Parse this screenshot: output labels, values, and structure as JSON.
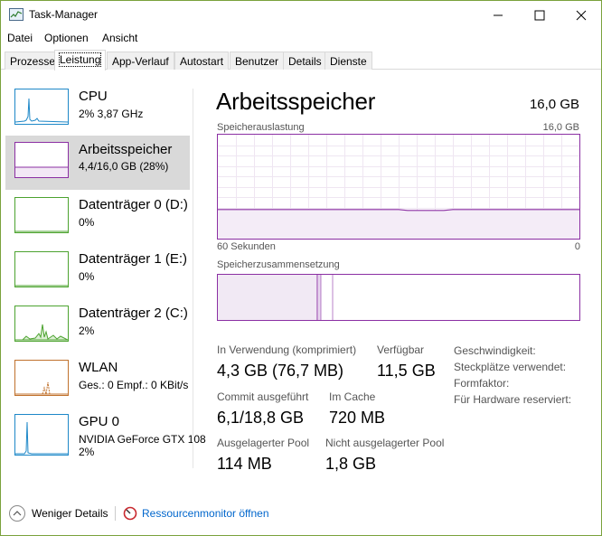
{
  "window": {
    "title": "Task-Manager"
  },
  "menu": {
    "file": "Datei",
    "options": "Optionen",
    "view": "Ansicht"
  },
  "tabs": [
    {
      "label": "Prozesse",
      "active": false
    },
    {
      "label": "Leistung",
      "active": true
    },
    {
      "label": "App-Verlauf",
      "active": false
    },
    {
      "label": "Autostart",
      "active": false
    },
    {
      "label": "Benutzer",
      "active": false
    },
    {
      "label": "Details",
      "active": false
    },
    {
      "label": "Dienste",
      "active": false
    }
  ],
  "sidebar": {
    "items": [
      {
        "title": "CPU",
        "sub": "2%  3,87 GHz",
        "color": "#1e88c8"
      },
      {
        "title": "Arbeitsspeicher",
        "sub": "4,4/16,0 GB (28%)",
        "color": "#8b2fa3",
        "selected": true
      },
      {
        "title": "Datenträger 0 (D:)",
        "sub": "0%",
        "color": "#4ca32f"
      },
      {
        "title": "Datenträger 1 (E:)",
        "sub": "0%",
        "color": "#4ca32f"
      },
      {
        "title": "Datenträger 2 (C:)",
        "sub": "2%",
        "color": "#4ca32f"
      },
      {
        "title": "WLAN",
        "sub": "Ges.: 0  Empf.: 0 KBit/s",
        "color": "#c0712c"
      },
      {
        "title": "GPU 0",
        "sub": "NVIDIA GeForce GTX 108",
        "sub2": "2%",
        "color": "#1e88c8"
      }
    ]
  },
  "panel": {
    "title": "Arbeitsspeicher",
    "total": "16,0 GB",
    "usage_label": "Speicherauslastung",
    "usage_max": "16,0 GB",
    "time_left": "60 Sekunden",
    "time_right": "0",
    "composition_label": "Speicherzusammensetzung",
    "usage_level": 0.28,
    "stats": {
      "in_use_label": "In Verwendung (komprimiert)",
      "in_use_value": "4,3 GB (76,7 MB)",
      "available_label": "Verfügbar",
      "available_value": "11,5 GB",
      "committed_label": "Commit ausgeführt",
      "committed_value": "6,1/18,8 GB",
      "cached_label": "Im Cache",
      "cached_value": "720 MB",
      "paged_label": "Ausgelagerter Pool",
      "paged_value": "114 MB",
      "nonpaged_label": "Nicht ausgelagerter Pool",
      "nonpaged_value": "1,8 GB"
    },
    "info": {
      "speed": "Geschwindigkeit:",
      "slots": "Steckplätze verwendet:",
      "form_factor": "Formfaktor:",
      "reserved": "Für Hardware reserviert:"
    }
  },
  "footer": {
    "fewer_details": "Weniger Details",
    "resource_monitor": "Ressourcenmonitor öffnen"
  }
}
